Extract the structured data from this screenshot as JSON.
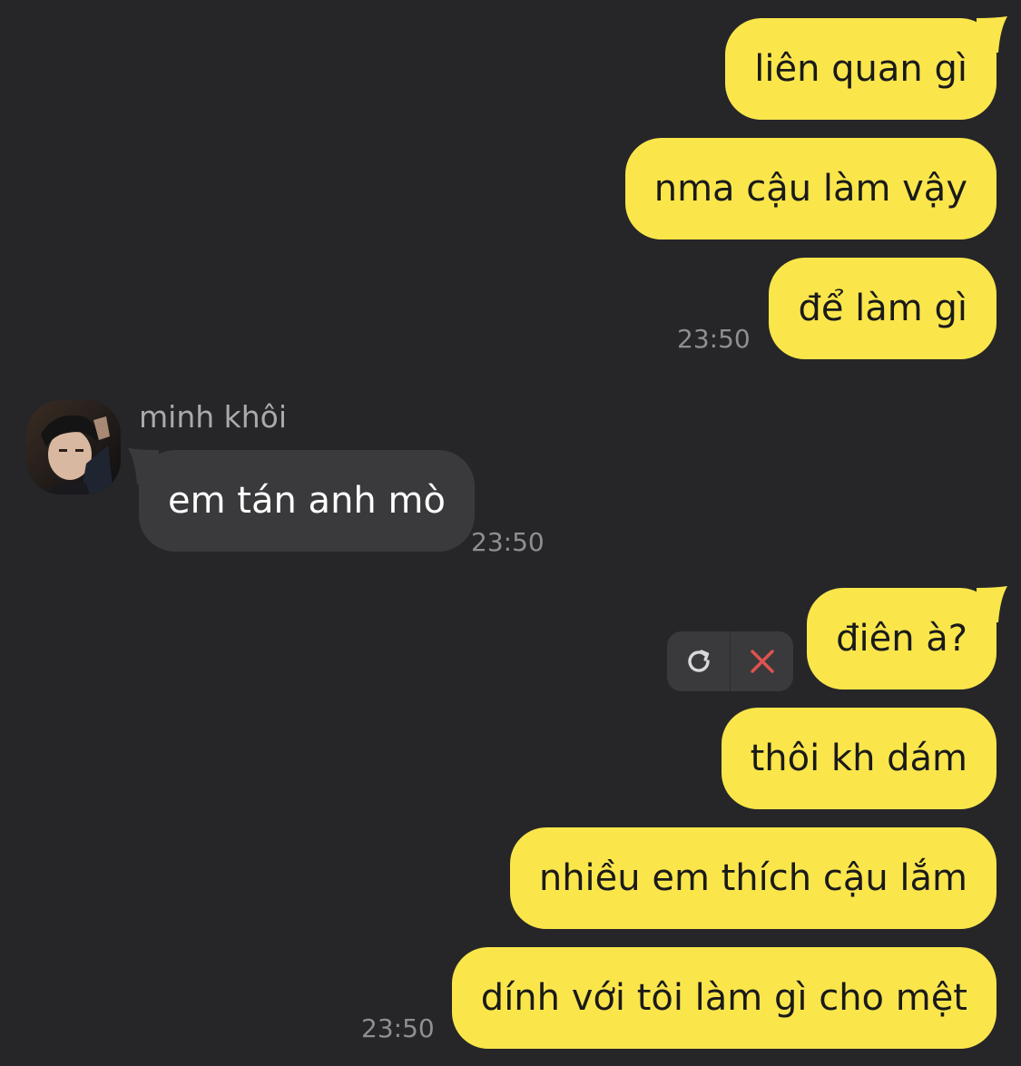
{
  "messages_top": [
    {
      "text": "liên quan gì"
    },
    {
      "text": "nma cậu làm vậy"
    },
    {
      "text": "để làm gì"
    }
  ],
  "time_1": "23:50",
  "incoming": {
    "sender": "minh khôi",
    "text": "em tán anh mò",
    "time": "23:50"
  },
  "failed_message": {
    "text": "điên à?",
    "retry_icon": "retry-icon",
    "cancel_icon": "close-icon"
  },
  "messages_bottom": [
    {
      "text": "thôi kh dám"
    },
    {
      "text": "nhiều em thích cậu lắm"
    },
    {
      "text": "dính với tôi làm gì cho mệt"
    }
  ],
  "time_2": "23:50",
  "colors": {
    "background": "#262628",
    "outgoing_bubble": "#FAE64B",
    "incoming_bubble": "#3A3A3C",
    "timestamp": "#8E8E93",
    "cancel_red": "#E0534F"
  }
}
